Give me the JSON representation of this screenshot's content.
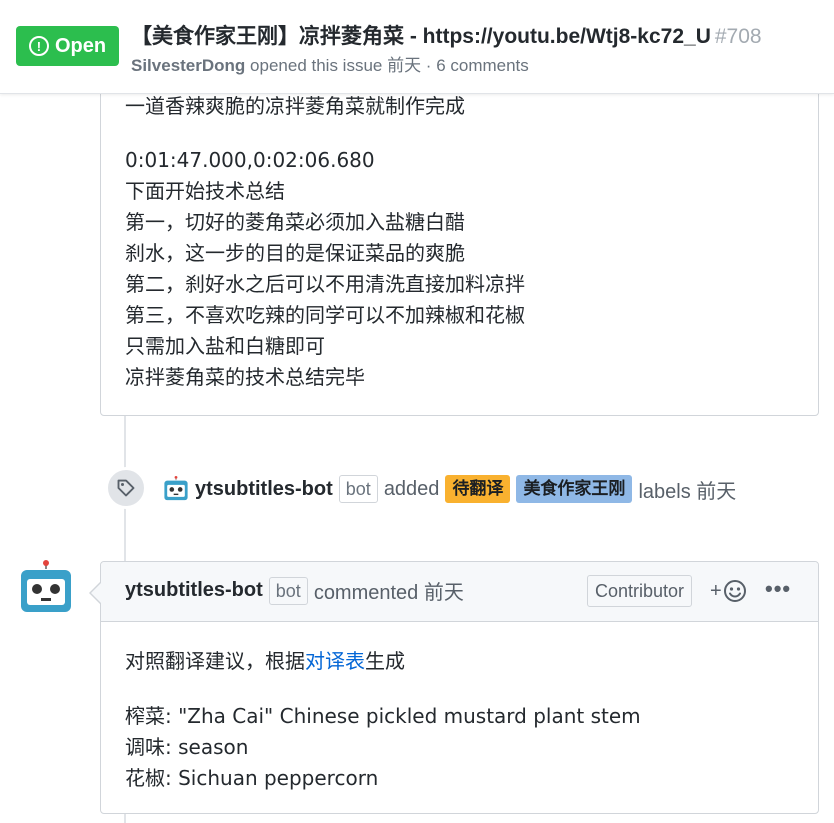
{
  "issue": {
    "state": "Open",
    "title": "【美食作家王刚】凉拌菱角菜 - https://youtu.be/Wtj8-kc72_U",
    "number": "#708",
    "author": "SilvesterDong",
    "meta_suffix": "opened this issue 前天 · 6 comments"
  },
  "comment1": {
    "lines_a": [
      "一道香辣爽脆的凉拌菱角菜就制作完成"
    ],
    "lines_b": [
      "0:01:47.000,0:02:06.680",
      "下面开始技术总结",
      "第一，切好的菱角菜必须加入盐糖白醋",
      "刹水，这一步的目的是保证菜品的爽脆",
      "第二，刹好水之后可以不用清洗直接加料凉拌",
      "第三，不喜欢吃辣的同学可以不加辣椒和花椒",
      "只需加入盐和白糖即可",
      "凉拌菱角菜的技术总结完毕"
    ]
  },
  "label_event": {
    "actor": "ytsubtitles-bot",
    "bot_tag": "bot",
    "action": "added",
    "labels": [
      {
        "name": "待翻译",
        "color": "#f9b12f"
      },
      {
        "name": "美食作家王刚",
        "color": "#8fb8e6"
      }
    ],
    "suffix": "labels 前天"
  },
  "comment2": {
    "author": "ytsubtitles-bot",
    "bot_tag": "bot",
    "action": "commented 前天",
    "role": "Contributor",
    "reaction": "+",
    "more": "•••",
    "intro_prefix": "对照翻译建议，根据",
    "intro_link": "对译表",
    "intro_suffix": "生成",
    "terms": [
      "榨菜: \"Zha Cai\" Chinese pickled mustard plant stem",
      "调味: season",
      "花椒: Sichuan peppercorn"
    ]
  },
  "colors": {
    "open_green": "#2cbe4e",
    "link_blue": "#0366d6",
    "bot_teal": "#3aa0c9"
  }
}
